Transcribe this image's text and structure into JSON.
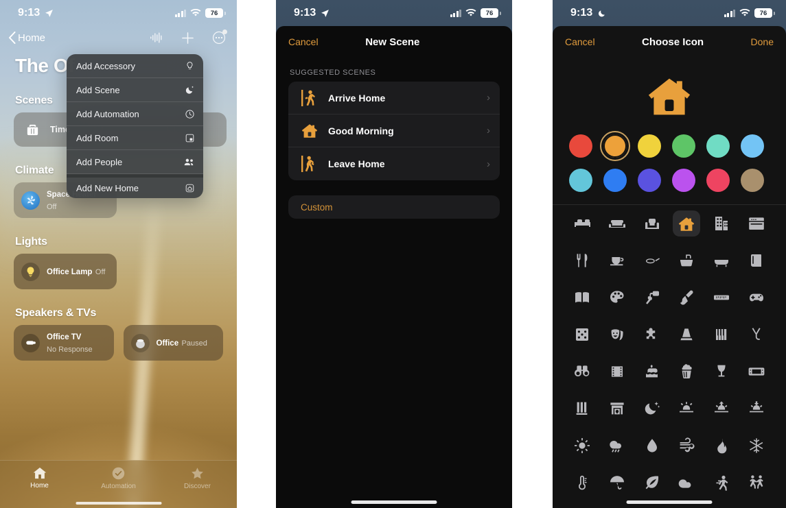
{
  "panels": {
    "home": {
      "status": {
        "time": "9:13",
        "location_icon": "location-arrow-icon",
        "battery": "76"
      },
      "nav": {
        "back_label": "Home",
        "siri_icon": "waveform-icon",
        "add_icon": "plus-icon",
        "more_icon": "ellipsis-circle-icon"
      },
      "title": "The Of",
      "menu": {
        "items": [
          {
            "label": "Add Accessory",
            "icon": "lightbulb-icon"
          },
          {
            "label": "Add Scene",
            "icon": "moon-stars-icon"
          },
          {
            "label": "Add Automation",
            "icon": "clock-circle-icon"
          },
          {
            "label": "Add Room",
            "icon": "room-square-icon"
          },
          {
            "label": "Add People",
            "icon": "people-icon"
          },
          {
            "label": "Add New Home",
            "icon": "house-square-icon"
          }
        ]
      },
      "sections": [
        {
          "title": "Scenes",
          "tiles": [
            {
              "name": "Time",
              "sub": "",
              "icon": "briefcase-icon"
            }
          ]
        },
        {
          "title": "Climate",
          "tiles": [
            {
              "name": "Space Heater",
              "sub": "Off",
              "icon": "fan-icon"
            }
          ]
        },
        {
          "title": "Lights",
          "tiles": [
            {
              "name": "Office Lamp",
              "sub": "Off",
              "icon": "lightbulb-on-icon"
            }
          ]
        },
        {
          "title": "Speakers & TVs",
          "tiles": [
            {
              "name": "Office TV",
              "sub": "No Response",
              "icon": "appletv-remote-icon"
            },
            {
              "name": "Office",
              "sub": "Paused",
              "icon": "homepod-icon"
            }
          ]
        }
      ],
      "tabs": [
        {
          "label": "Home",
          "icon": "house-icon",
          "active": true
        },
        {
          "label": "Automation",
          "icon": "automation-clock-icon",
          "active": false
        },
        {
          "label": "Discover",
          "icon": "star-icon",
          "active": false
        }
      ]
    },
    "new_scene": {
      "status": {
        "time": "9:13",
        "location_icon": "location-arrow-icon",
        "battery": "76"
      },
      "nav": {
        "cancel": "Cancel",
        "title": "New Scene"
      },
      "group_header": "SUGGESTED SCENES",
      "scenes": [
        {
          "label": "Arrive Home",
          "icon": "person-walking-in-icon"
        },
        {
          "label": "Good Morning",
          "icon": "house-icon"
        },
        {
          "label": "Leave Home",
          "icon": "person-walking-out-icon"
        }
      ],
      "custom_label": "Custom"
    },
    "choose_icon": {
      "status": {
        "time": "9:13",
        "moon_icon": "moon-icon",
        "battery": "76"
      },
      "nav": {
        "cancel": "Cancel",
        "title": "Choose Icon",
        "done": "Done"
      },
      "preview_icon": "house-icon",
      "accent": "#e8a03c",
      "colors": [
        {
          "name": "red",
          "hex": "#e8493c",
          "selected": false
        },
        {
          "name": "orange",
          "hex": "#eda13a",
          "selected": true
        },
        {
          "name": "yellow",
          "hex": "#f0d23c",
          "selected": false
        },
        {
          "name": "green",
          "hex": "#5ec567",
          "selected": false
        },
        {
          "name": "mint",
          "hex": "#70dcc4",
          "selected": false
        },
        {
          "name": "light-blue",
          "hex": "#73c4f5",
          "selected": false
        },
        {
          "name": "cyan",
          "hex": "#63c6da",
          "selected": false
        },
        {
          "name": "blue",
          "hex": "#2f7df2",
          "selected": false
        },
        {
          "name": "indigo",
          "hex": "#5a52e0",
          "selected": false
        },
        {
          "name": "purple",
          "hex": "#bb52ee",
          "selected": false
        },
        {
          "name": "pink",
          "hex": "#ee4461",
          "selected": false
        },
        {
          "name": "brown",
          "hex": "#a9906d",
          "selected": false
        }
      ],
      "icons": [
        {
          "name": "bed-icon",
          "selected": false
        },
        {
          "name": "sofa-icon",
          "selected": false
        },
        {
          "name": "armchair-icon",
          "selected": false
        },
        {
          "name": "house-icon",
          "selected": true
        },
        {
          "name": "building-icon",
          "selected": false
        },
        {
          "name": "oven-icon",
          "selected": false
        },
        {
          "name": "fork-knife-icon",
          "selected": false
        },
        {
          "name": "coffee-cup-icon",
          "selected": false
        },
        {
          "name": "frying-pan-icon",
          "selected": false
        },
        {
          "name": "sink-icon",
          "selected": false
        },
        {
          "name": "bathtub-icon",
          "selected": false
        },
        {
          "name": "book-closed-icon",
          "selected": false
        },
        {
          "name": "book-open-icon",
          "selected": false
        },
        {
          "name": "palette-icon",
          "selected": false
        },
        {
          "name": "paint-roller-icon",
          "selected": false
        },
        {
          "name": "paintbrush-icon",
          "selected": false
        },
        {
          "name": "ruler-icon",
          "selected": false
        },
        {
          "name": "gamepad-icon",
          "selected": false
        },
        {
          "name": "dice-icon",
          "selected": false
        },
        {
          "name": "theater-masks-icon",
          "selected": false
        },
        {
          "name": "puzzle-piece-icon",
          "selected": false
        },
        {
          "name": "metronome-icon",
          "selected": false
        },
        {
          "name": "piano-keys-icon",
          "selected": false
        },
        {
          "name": "tuning-fork-icon",
          "selected": false
        },
        {
          "name": "binoculars-icon",
          "selected": false
        },
        {
          "name": "film-strip-icon",
          "selected": false
        },
        {
          "name": "cake-icon",
          "selected": false
        },
        {
          "name": "popcorn-icon",
          "selected": false
        },
        {
          "name": "wine-glass-icon",
          "selected": false
        },
        {
          "name": "tv-screen-icon",
          "selected": false
        },
        {
          "name": "test-tubes-icon",
          "selected": false
        },
        {
          "name": "fireplace-icon",
          "selected": false
        },
        {
          "name": "moon-stars-icon",
          "selected": false
        },
        {
          "name": "sun-horizon-icon",
          "selected": false
        },
        {
          "name": "sunrise-icon",
          "selected": false
        },
        {
          "name": "sunset-icon",
          "selected": false
        },
        {
          "name": "sun-icon",
          "selected": false
        },
        {
          "name": "rain-cloud-icon",
          "selected": false
        },
        {
          "name": "water-drop-icon",
          "selected": false
        },
        {
          "name": "wind-icon",
          "selected": false
        },
        {
          "name": "flame-icon",
          "selected": false
        },
        {
          "name": "snowflake-icon",
          "selected": false
        },
        {
          "name": "thermometer-icon",
          "selected": false
        },
        {
          "name": "umbrella-icon",
          "selected": false
        },
        {
          "name": "leaf-icon",
          "selected": false
        },
        {
          "name": "cloud-icon",
          "selected": false
        },
        {
          "name": "running-person-icon",
          "selected": false
        },
        {
          "name": "dancing-people-icon",
          "selected": false
        }
      ]
    }
  }
}
